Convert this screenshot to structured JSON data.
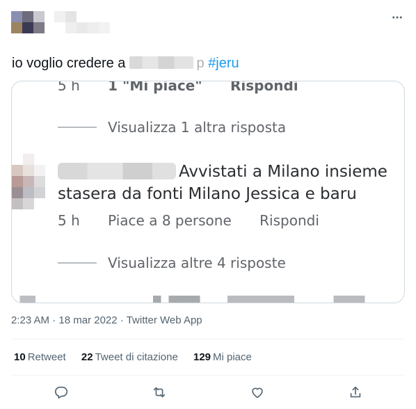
{
  "tweet": {
    "text_before": "io voglio credere a",
    "text_after": "p",
    "hashtag": "#jeru"
  },
  "media": {
    "top_row": {
      "time": "5 h",
      "likes": "1 \"Mi piace\"",
      "reply": "Rispondi"
    },
    "view_more_1": "Visualizza 1 altra risposta",
    "comment": {
      "line1_rest": "Avvistati a Milano insieme",
      "line2": "stasera da fonti Milano Jessica e baru"
    },
    "comment_meta": {
      "time": "5 h",
      "likes": "Piace a 8 persone",
      "reply": "Rispondi"
    },
    "view_more_2": "Visualizza altre 4 risposte"
  },
  "timestamp": {
    "time": "2:23 AM",
    "sep1": "·",
    "date": "18 mar 2022",
    "sep2": "·",
    "source": "Twitter Web App"
  },
  "stats": {
    "retweets_count": "10",
    "retweets_label": "Retweet",
    "quotes_count": "22",
    "quotes_label": "Tweet di citazione",
    "likes_count": "129",
    "likes_label": "Mi piace"
  },
  "icons": {
    "more": "more-horizontal-icon",
    "reply": "reply-icon",
    "retweet": "retweet-icon",
    "like": "heart-icon",
    "share": "share-icon"
  },
  "colors": {
    "accent": "#1d9bf0",
    "secondary_text": "#536471",
    "border": "#cfd9de"
  }
}
